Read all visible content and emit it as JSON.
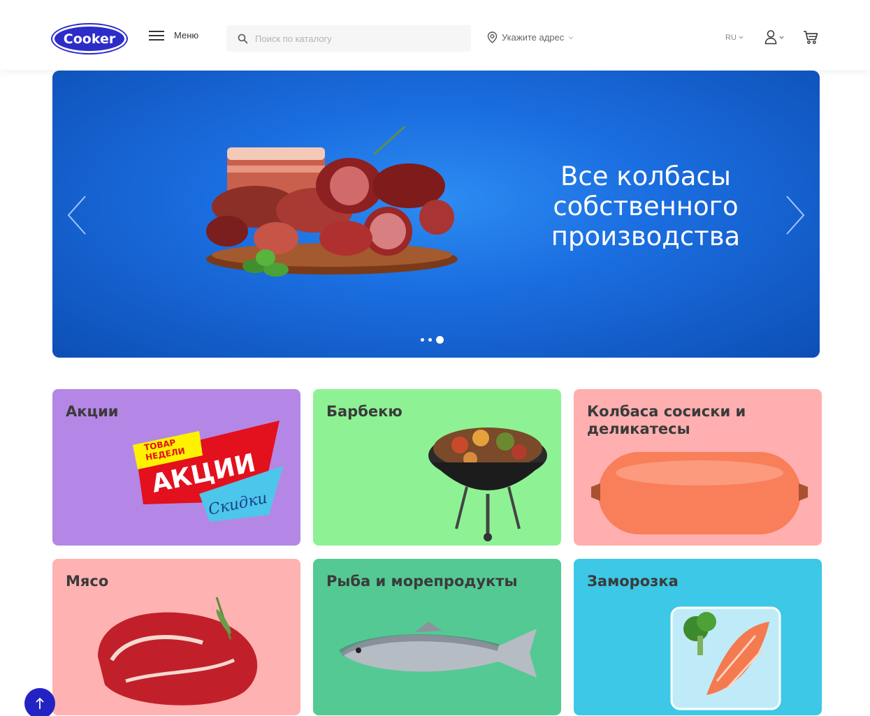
{
  "header": {
    "logo_text": "Cooker",
    "menu_label": "Меню",
    "search_placeholder": "Поиск по каталогу",
    "address_label": "Укажите адрес",
    "lang_label": "RU"
  },
  "banner": {
    "title": "Все колбасы собственного производства",
    "slides_count": 3,
    "active_slide": 3
  },
  "categories": [
    {
      "title": "Акции",
      "color": "#b487e6",
      "art_text": [
        "ТОВАР",
        "НЕДЕЛИ",
        "АКЦИИ",
        "Скидки"
      ]
    },
    {
      "title": "Барбекю",
      "color": "#8ef294"
    },
    {
      "title": "Колбаса сосиски и деликатесы",
      "color": "#ffafaf"
    },
    {
      "title": "Мясо",
      "color": "#ffb2b2"
    },
    {
      "title": "Рыба и морепродукты",
      "color": "#55c994"
    },
    {
      "title": "Заморозка",
      "color": "#3cc8e6"
    }
  ],
  "icons": {
    "search": "search-icon",
    "location": "location-pin-icon",
    "user": "user-icon",
    "cart": "cart-icon",
    "scroll_top": "arrow-up-icon"
  },
  "colors": {
    "brand": "#2c2cc9",
    "banner": "#1b6ee0"
  }
}
